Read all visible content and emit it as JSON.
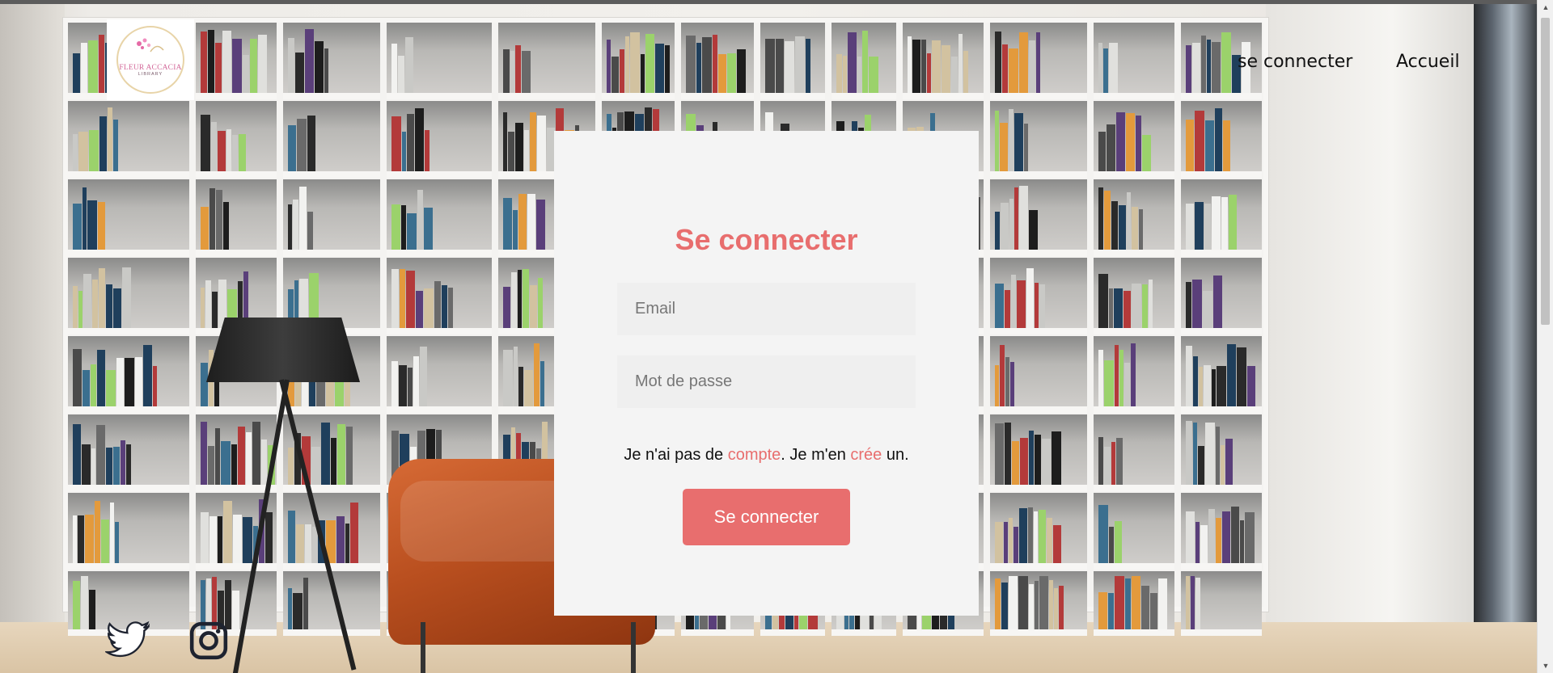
{
  "header": {
    "logo": {
      "text": "FLEUR ACCACIA",
      "subtext": "LIBRARY"
    },
    "nav": [
      {
        "label": "se connecter"
      },
      {
        "label": "Accueil"
      }
    ]
  },
  "login": {
    "title": "Se connecter",
    "email_placeholder": "Email",
    "password_placeholder": "Mot de passe",
    "hint_before": "Je n'ai pas de ",
    "hint_link1": "compte",
    "hint_middle": ". Je m'en ",
    "hint_link2": "crée",
    "hint_after": " un.",
    "submit_label": "Se connecter"
  },
  "social": [
    {
      "icon": "twitter-icon"
    },
    {
      "icon": "instagram-icon"
    }
  ],
  "colors": {
    "accent": "#e86e6e",
    "card_bg": "#f4f4f4",
    "field_bg": "#efefef",
    "text": "#111111"
  }
}
